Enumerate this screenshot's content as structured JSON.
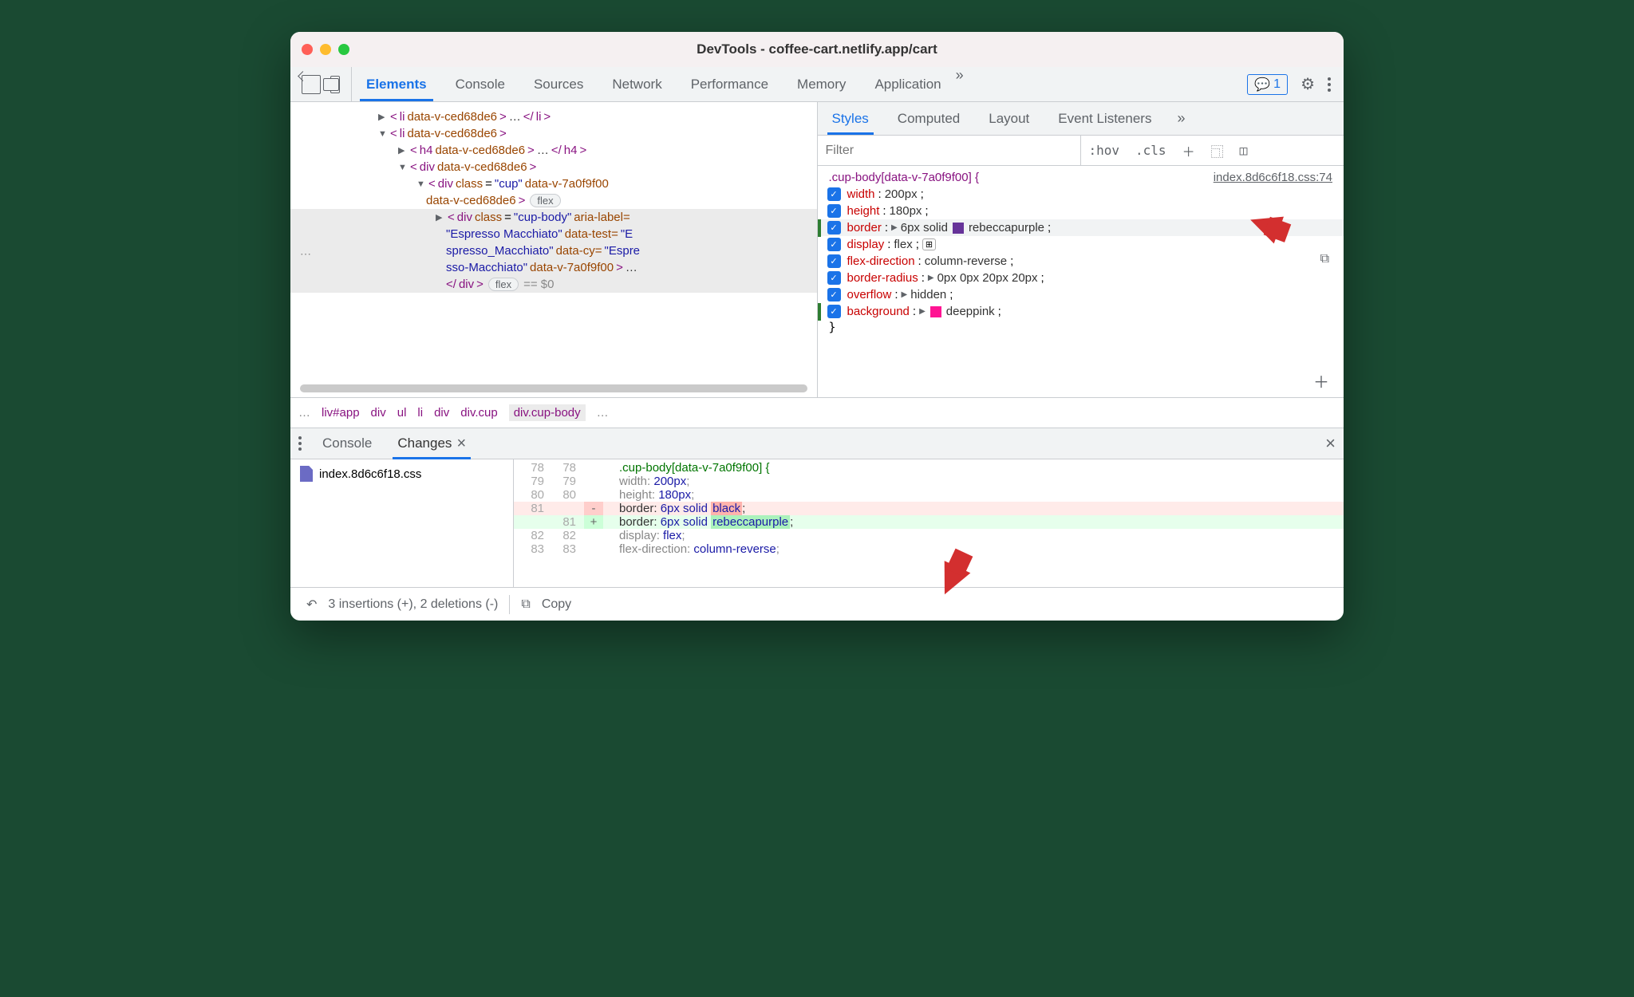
{
  "title": "DevTools - coffee-cart.netlify.app/cart",
  "tabs": [
    "Elements",
    "Console",
    "Sources",
    "Network",
    "Performance",
    "Memory",
    "Application"
  ],
  "activeTab": 0,
  "badgeCount": "1",
  "dom": {
    "l1": {
      "tag": "li",
      "attr": "data-v-ced68de6",
      "collapsed": "…"
    },
    "l2": {
      "tag": "li",
      "attr": "data-v-ced68de6"
    },
    "l3": {
      "tag": "h4",
      "attr": "data-v-ced68de6",
      "collapsed": "…"
    },
    "l4": {
      "tag": "div",
      "attr": "data-v-ced68de6"
    },
    "l5": {
      "tag": "div",
      "cls": "cup",
      "a1": "data-v-7a0f9f00",
      "a2": "data-v-ced68de6",
      "pill": "flex"
    },
    "sel": {
      "tag": "div",
      "cls": "cup-body",
      "aria": "aria-label=",
      "ariaV": "\"Espresso Macchiato\"",
      "dt": "data-test=",
      "dtV": "\"Espresso_Macchiato\"",
      "dc": "data-cy=",
      "dcV": "\"Espresso-Macchiato\"",
      "dv": "data-v-7a0f9f00",
      "ell": "…"
    },
    "close": "div",
    "pill2": "flex",
    "eq": "== $0"
  },
  "styleTabs": [
    "Styles",
    "Computed",
    "Layout",
    "Event Listeners"
  ],
  "filter": "Filter",
  "hov": ":hov",
  "cls": ".cls",
  "selector": ".cup-body[data-v-7a0f9f00] {",
  "link": "index.8d6c6f18.css:74",
  "props": [
    {
      "n": "width",
      "v": "200px"
    },
    {
      "n": "height",
      "v": "180px"
    },
    {
      "n": "border",
      "v": "6px solid ",
      "sw": "rp",
      "vv": "rebeccapurple",
      "mod": true,
      "ex": true
    },
    {
      "n": "display",
      "v": "flex",
      "ex": true,
      "flex": true
    },
    {
      "n": "flex-direction",
      "v": "column-reverse"
    },
    {
      "n": "border-radius",
      "v": "0px 0px 20px 20px",
      "ex": true
    },
    {
      "n": "overflow",
      "v": "hidden",
      "ex": true
    },
    {
      "n": "background",
      "v": "",
      "sw": "dp",
      "vv": "deeppink",
      "mod": true,
      "ex": true
    }
  ],
  "brace": "}",
  "breadcrumbs": [
    "liv#app",
    "div",
    "ul",
    "li",
    "div",
    "div.cup",
    "div.cup-body"
  ],
  "drawerTabs": [
    "Console",
    "Changes"
  ],
  "file": "index.8d6c6f18.css",
  "diff": {
    "head": {
      "a": "78",
      "b": "78",
      "t": ".cup-body[data-v-7a0f9f00] {"
    },
    "l2": {
      "a": "79",
      "b": "79",
      "p": "width",
      "v": "200px"
    },
    "l3": {
      "a": "80",
      "b": "80",
      "p": "height",
      "v": "180px"
    },
    "del": {
      "a": "81",
      "b": "",
      "m": "-",
      "p": "border",
      "v": "6px solid ",
      "hv": "black"
    },
    "add": {
      "a": "",
      "b": "81",
      "m": "+",
      "p": "border",
      "v": "6px solid ",
      "hv": "rebeccapurple"
    },
    "l6": {
      "a": "82",
      "b": "82",
      "p": "display",
      "v": "flex"
    },
    "l7": {
      "a": "83",
      "b": "83",
      "p": "flex-direction",
      "v": "column-reverse"
    }
  },
  "summary": "3 insertions (+), 2 deletions (-)",
  "copy": "Copy",
  "ell": "…"
}
